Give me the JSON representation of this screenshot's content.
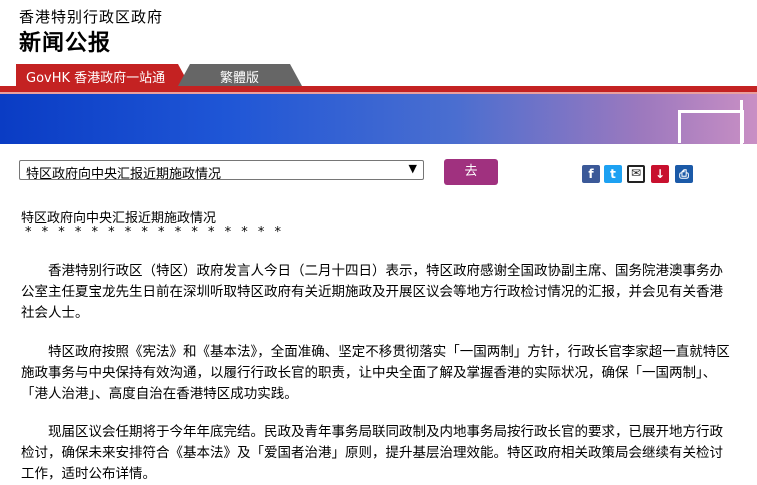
{
  "header": {
    "gov_name": "香港特别行政区政府",
    "section_title": "新闻公报"
  },
  "tabs": {
    "govhk_label": "GovHK 香港政府一站通",
    "trad_label": "繁體版"
  },
  "nav": {
    "selected_value": "特区政府向中央汇报近期施政情况",
    "go_label": "去"
  },
  "share": {
    "icons": [
      "facebook-icon",
      "twitter-icon",
      "email-icon",
      "save-icon",
      "print-icon"
    ],
    "facebook_glyph": "f",
    "twitter_glyph": "t",
    "email_glyph": "✉",
    "save_glyph": "↓",
    "print_glyph": "⎙"
  },
  "article": {
    "headline": "特区政府向中央汇报近期施政情况",
    "stars": "* * * * * * * * * * * * * * * *",
    "paragraphs": [
      "　　香港特别行政区（特区）政府发言人今日（二月十四日）表示，特区政府感谢全国政协副主席、国务院港澳事务办公室主任夏宝龙先生日前在深圳听取特区政府有关近期施政及开展区议会等地方行政检讨情况的汇报，并会见有关香港社会人士。",
      "　　特区政府按照《宪法》和《基本法》，全面准确、坚定不移贯彻落实「一国两制」方针，行政长官李家超一直就特区施政事务与中央保持有效沟通，以履行行政长官的职责，让中央全面了解及掌握香港的实际状况，确保「一国两制」、「港人治港」、高度自治在香港特区成功实践。",
      "　　现届区议会任期将于今年年底完结。民政及青年事务局联同政制及内地事务局按行政长官的要求，已展开地方行政检讨，确保未来安排符合《基本法》及「爱国者治港」原则，提升基层治理效能。特区政府相关政策局会继续有关检讨工作，适时公布详情。"
    ]
  },
  "colors": {
    "tab_red": "#c42222",
    "tab_gray": "#666666",
    "go_button": "#a0317f",
    "banner_blue": "#0a3cc4"
  }
}
